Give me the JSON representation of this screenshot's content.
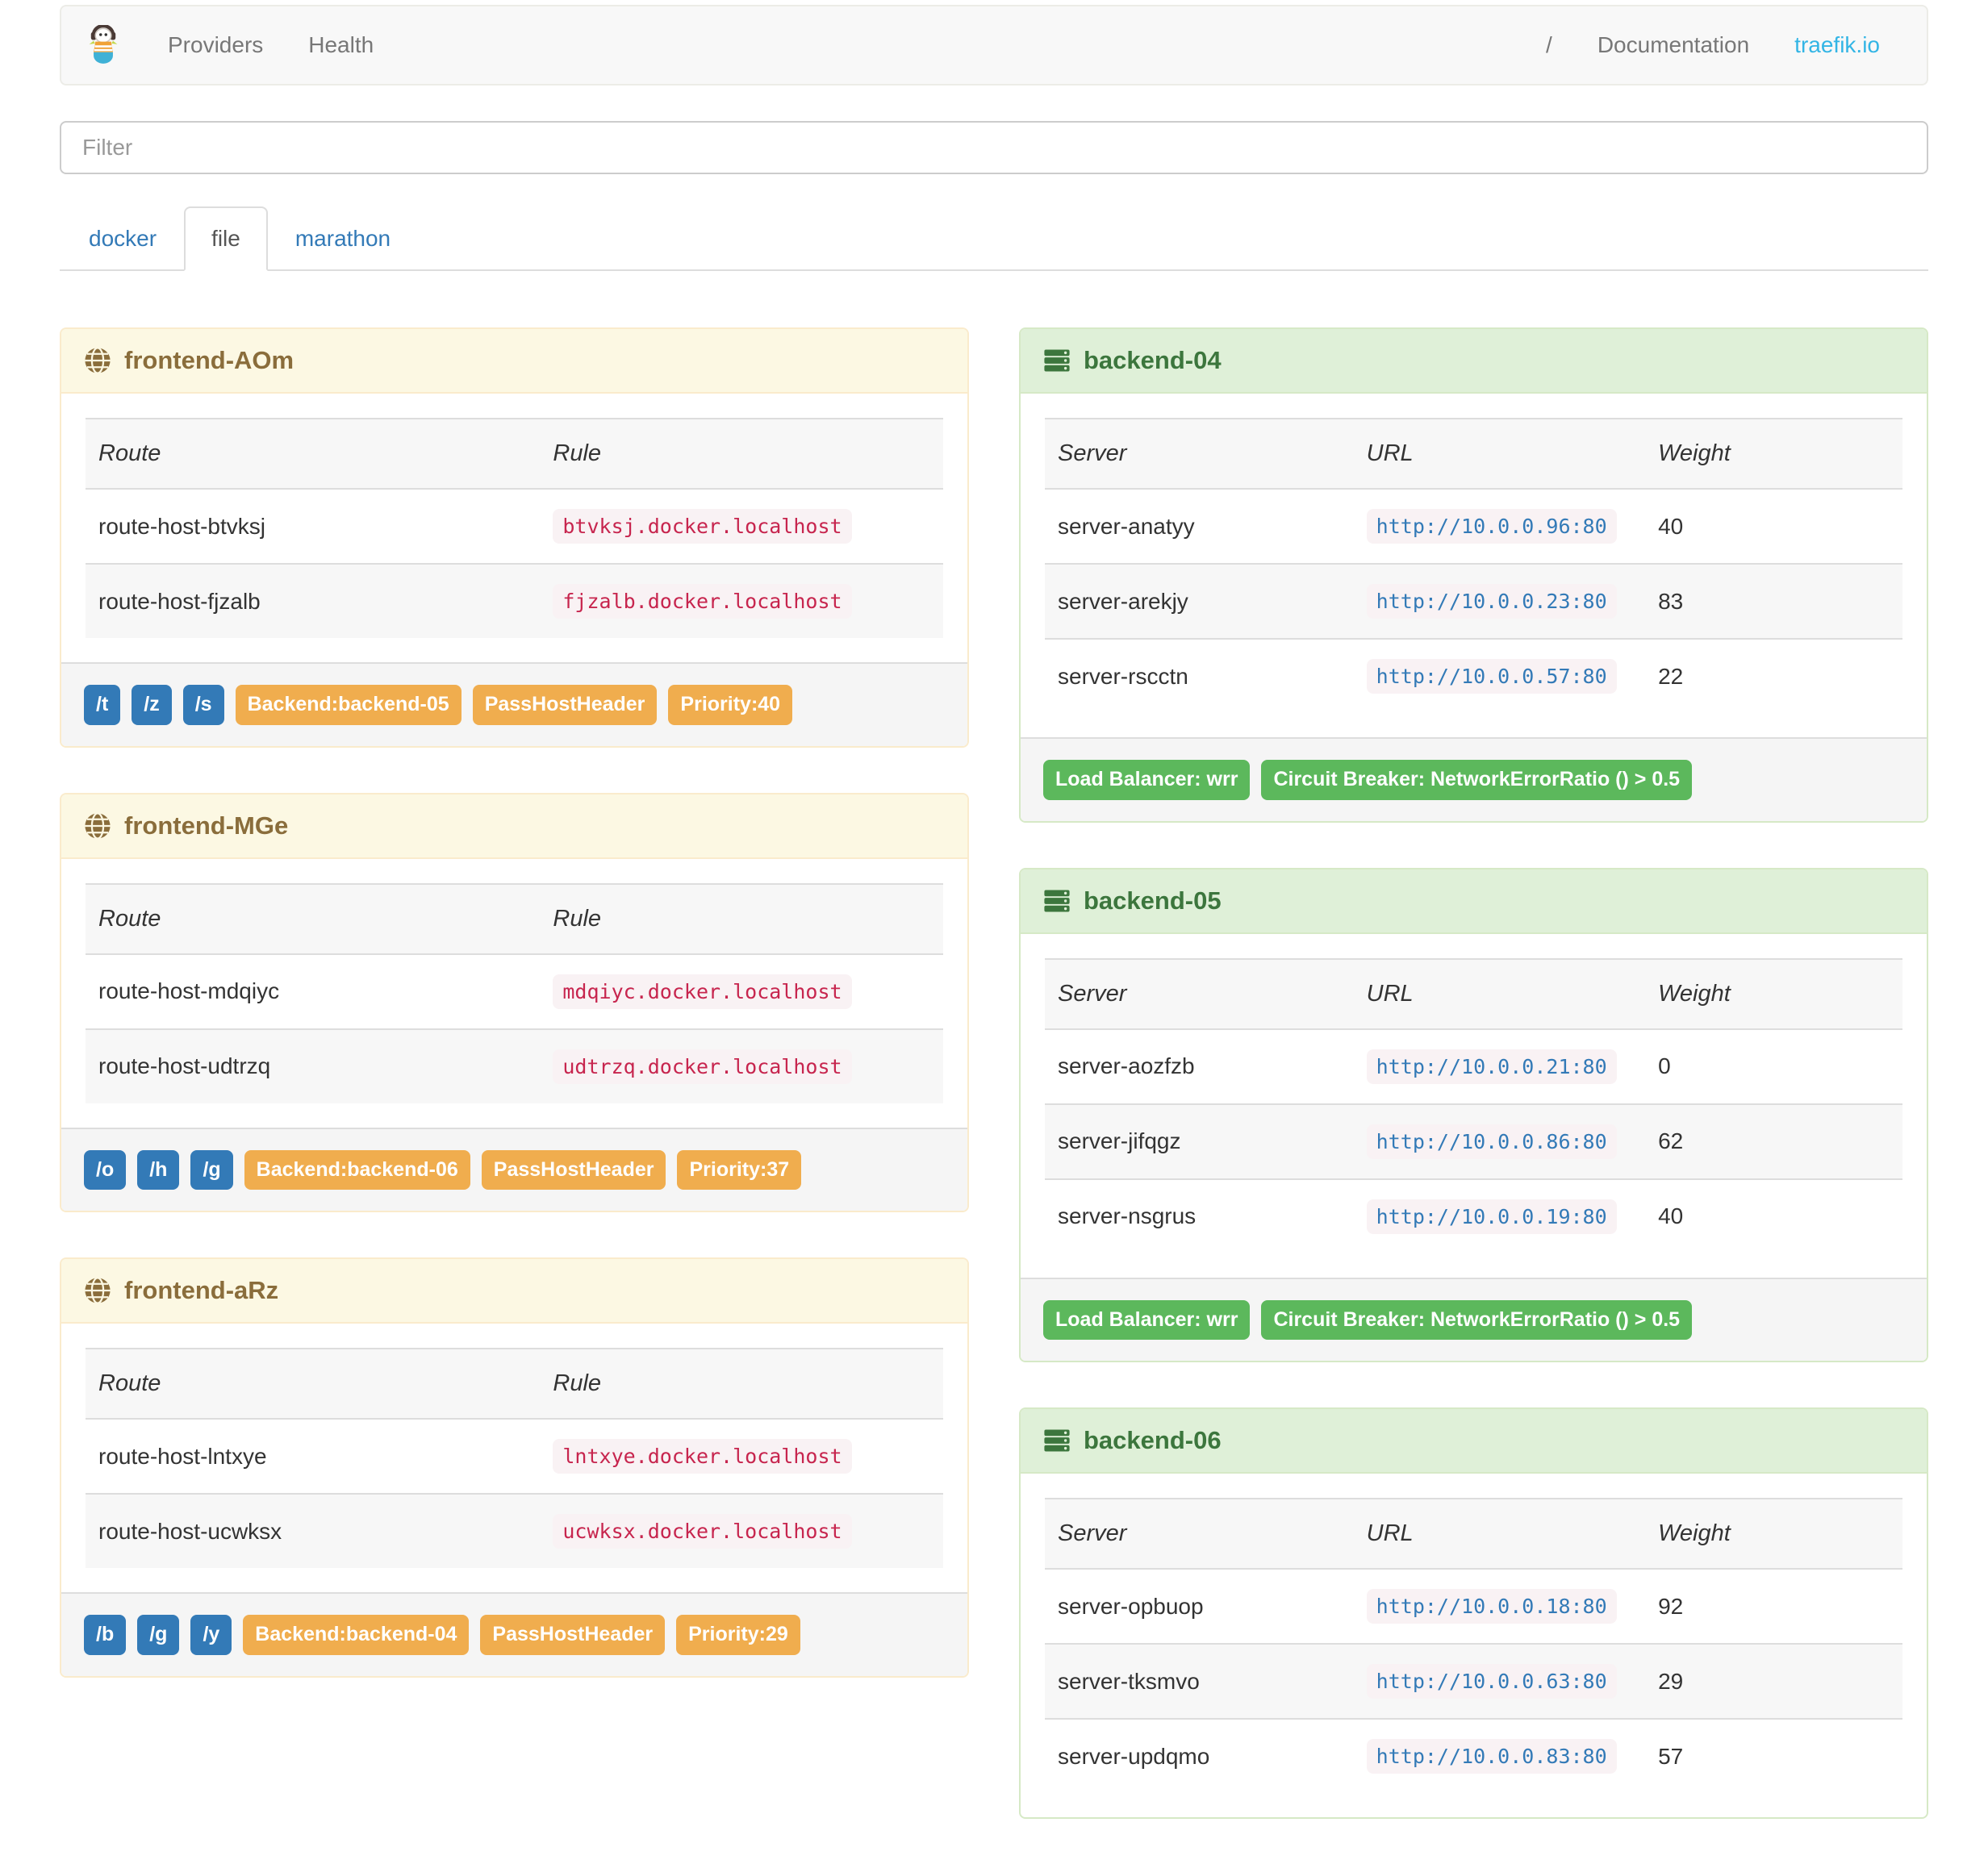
{
  "navbar": {
    "left_items": [
      {
        "label": "Providers"
      },
      {
        "label": "Health"
      }
    ],
    "right_items": [
      {
        "label": "/"
      },
      {
        "label": "Documentation"
      },
      {
        "label": "traefik.io"
      }
    ]
  },
  "filter": {
    "placeholder": "Filter",
    "value": ""
  },
  "tabs": [
    {
      "label": "docker",
      "active": false
    },
    {
      "label": "file",
      "active": true
    },
    {
      "label": "marathon",
      "active": false
    }
  ],
  "frontends": [
    {
      "name": "frontend-AOm",
      "columns": [
        "Route",
        "Rule"
      ],
      "routes": [
        {
          "route": "route-host-btvksj",
          "rule": "btvksj.docker.localhost"
        },
        {
          "route": "route-host-fjzalb",
          "rule": "fjzalb.docker.localhost"
        }
      ],
      "entry_points": [
        "/t",
        "/z",
        "/s"
      ],
      "details": [
        "Backend:backend-05",
        "PassHostHeader",
        "Priority:40"
      ]
    },
    {
      "name": "frontend-MGe",
      "columns": [
        "Route",
        "Rule"
      ],
      "routes": [
        {
          "route": "route-host-mdqiyc",
          "rule": "mdqiyc.docker.localhost"
        },
        {
          "route": "route-host-udtrzq",
          "rule": "udtrzq.docker.localhost"
        }
      ],
      "entry_points": [
        "/o",
        "/h",
        "/g"
      ],
      "details": [
        "Backend:backend-06",
        "PassHostHeader",
        "Priority:37"
      ]
    },
    {
      "name": "frontend-aRz",
      "columns": [
        "Route",
        "Rule"
      ],
      "routes": [
        {
          "route": "route-host-lntxye",
          "rule": "lntxye.docker.localhost"
        },
        {
          "route": "route-host-ucwksx",
          "rule": "ucwksx.docker.localhost"
        }
      ],
      "entry_points": [
        "/b",
        "/g",
        "/y"
      ],
      "details": [
        "Backend:backend-04",
        "PassHostHeader",
        "Priority:29"
      ]
    }
  ],
  "backends": [
    {
      "name": "backend-04",
      "columns": [
        "Server",
        "URL",
        "Weight"
      ],
      "servers": [
        {
          "server": "server-anatyy",
          "url": "http://10.0.0.96:80",
          "weight": "40"
        },
        {
          "server": "server-arekjy",
          "url": "http://10.0.0.23:80",
          "weight": "83"
        },
        {
          "server": "server-rscctn",
          "url": "http://10.0.0.57:80",
          "weight": "22"
        }
      ],
      "badges": [
        "Load Balancer: wrr",
        "Circuit Breaker: NetworkErrorRatio () > 0.5"
      ]
    },
    {
      "name": "backend-05",
      "columns": [
        "Server",
        "URL",
        "Weight"
      ],
      "servers": [
        {
          "server": "server-aozfzb",
          "url": "http://10.0.0.21:80",
          "weight": "0"
        },
        {
          "server": "server-jifqgz",
          "url": "http://10.0.0.86:80",
          "weight": "62"
        },
        {
          "server": "server-nsgrus",
          "url": "http://10.0.0.19:80",
          "weight": "40"
        }
      ],
      "badges": [
        "Load Balancer: wrr",
        "Circuit Breaker: NetworkErrorRatio () > 0.5"
      ]
    },
    {
      "name": "backend-06",
      "columns": [
        "Server",
        "URL",
        "Weight"
      ],
      "servers": [
        {
          "server": "server-opbuop",
          "url": "http://10.0.0.18:80",
          "weight": "92"
        },
        {
          "server": "server-tksmvo",
          "url": "http://10.0.0.63:80",
          "weight": "29"
        },
        {
          "server": "server-updqmo",
          "url": "http://10.0.0.83:80",
          "weight": "57"
        }
      ],
      "badges": []
    }
  ],
  "colors": {
    "warning_bg": "#fcf8e3",
    "warning_border": "#faebcc",
    "warning_text": "#8a6d3b",
    "success_bg": "#dff0d8",
    "success_border": "#d6e9c6",
    "success_text": "#3c763d",
    "label_primary": "#337ab7",
    "label_warning": "#f0ad4e",
    "label_success": "#5cb85c",
    "code_text": "#c7254e",
    "code_bg": "#f9f2f4",
    "link": "#337ab7",
    "brand_link": "#33b5e5",
    "navbar_bg": "#f8f8f8",
    "footer_bg": "#f5f5f5"
  },
  "icons": {
    "brand": "traefik-logo",
    "frontend": "globe-icon",
    "backend": "server-icon"
  }
}
